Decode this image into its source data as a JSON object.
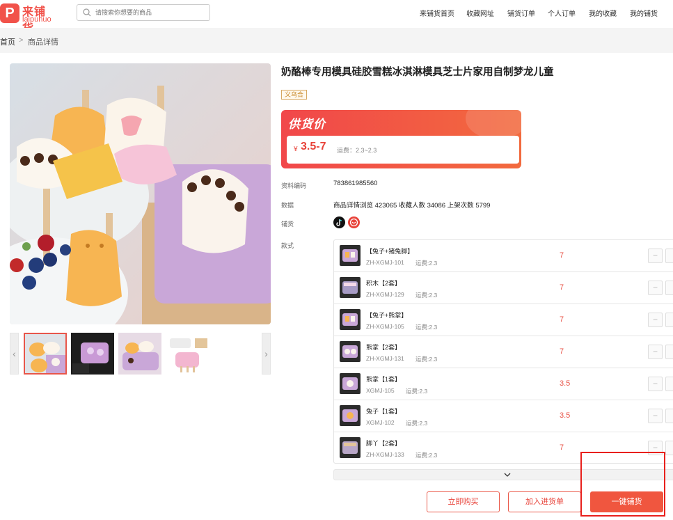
{
  "brand": {
    "cn": "来铺货",
    "en": "laipuhuo",
    "mark": "P"
  },
  "search": {
    "placeholder": "请搜索你想要的商品"
  },
  "nav": [
    "来铺货首页",
    "收藏网址",
    "铺货订单",
    "个人订单",
    "我的收藏",
    "我的铺货"
  ],
  "breadcrumb": {
    "home": "首页",
    "sep": ">",
    "current": "商品详情"
  },
  "product": {
    "title": "奶酪棒专用模具硅胶雪糕冰淇淋模具芝士片家用自制梦龙儿童",
    "origin_tag": "义乌合",
    "price_label": "供货价",
    "currency": "¥",
    "price": "3.5-7",
    "shipping": "运费：2.3~2.3",
    "code_label": "资料编码",
    "code": "783861985560",
    "stats_label": "数据",
    "stats": "商品详情浏览 423065  收藏人数 34086  上架次数 5799",
    "platform_label": "铺货",
    "style_label": "款式"
  },
  "variants": [
    {
      "name": "【兔子+猪兔脚】",
      "code": "ZH-XGMJ-101",
      "shipping": "运费:2.3",
      "price": "7"
    },
    {
      "name": "积木【2套】",
      "code": "ZH-XGMJ-129",
      "shipping": "运费:2.3",
      "price": "7"
    },
    {
      "name": "【兔子+熊掌】",
      "code": "ZH-XGMJ-105",
      "shipping": "运费:2.3",
      "price": "7"
    },
    {
      "name": "熊掌【2套】",
      "code": "ZH-XGMJ-131",
      "shipping": "运费:2.3",
      "price": "7"
    },
    {
      "name": "熊掌【1套】",
      "code": "XGMJ-105",
      "shipping": "运费:2.3",
      "price": "3.5"
    },
    {
      "name": "兔子【1套】",
      "code": "XGMJ-102",
      "shipping": "运费:2.3",
      "price": "3.5"
    },
    {
      "name": "脚丫【2套】",
      "code": "ZH-XGMJ-133",
      "shipping": "运费:2.3",
      "price": "7"
    }
  ],
  "actions": {
    "buy": "立即购买",
    "add": "加入进货单",
    "distribute": "一键铺货"
  },
  "colors": {
    "brand": "#f1524a",
    "accent": "#e8433a",
    "highlight": "#e8201c"
  },
  "icons": {
    "search": "search-icon",
    "expand": "chevron-down-icon",
    "prev": "chevron-left-icon",
    "next": "chevron-right-icon"
  }
}
